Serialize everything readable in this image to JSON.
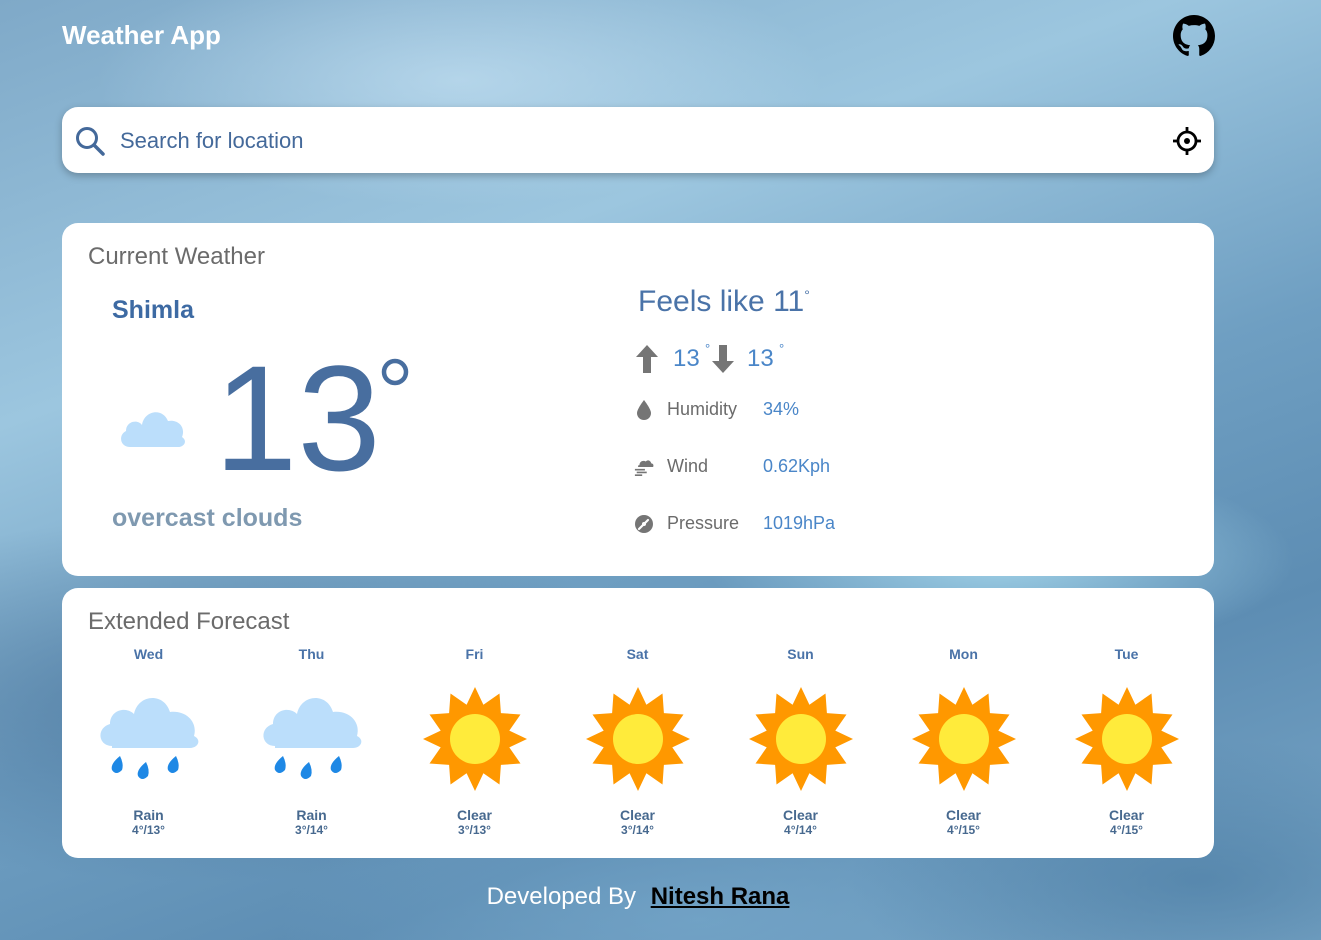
{
  "header": {
    "title": "Weather App",
    "github_icon": "github-icon"
  },
  "search": {
    "placeholder": "Search for location",
    "search_icon": "search-icon",
    "location_icon": "crosshair-icon"
  },
  "current": {
    "title": "Current Weather",
    "city": "Shimla",
    "temperature": "13",
    "description": "overcast clouds",
    "feels_like_label": "Feels like",
    "feels_like": "11",
    "max": "13",
    "min": "13",
    "degree": "°",
    "stats": [
      {
        "icon": "droplet-icon",
        "label": "Humidity",
        "value": "34%"
      },
      {
        "icon": "wind-icon",
        "label": "Wind",
        "value": "0.62Kph"
      },
      {
        "icon": "pressure-icon",
        "label": "Pressure",
        "value": "1019hPa"
      }
    ]
  },
  "forecast": {
    "title": "Extended Forecast",
    "days": [
      {
        "day": "Wed",
        "icon": "rain-icon",
        "condition": "Rain",
        "range": "4°/13°"
      },
      {
        "day": "Thu",
        "icon": "rain-icon",
        "condition": "Rain",
        "range": "3°/14°"
      },
      {
        "day": "Fri",
        "icon": "sun-icon",
        "condition": "Clear",
        "range": "3°/13°"
      },
      {
        "day": "Sat",
        "icon": "sun-icon",
        "condition": "Clear",
        "range": "3°/14°"
      },
      {
        "day": "Sun",
        "icon": "sun-icon",
        "condition": "Clear",
        "range": "4°/14°"
      },
      {
        "day": "Mon",
        "icon": "sun-icon",
        "condition": "Clear",
        "range": "4°/15°"
      },
      {
        "day": "Tue",
        "icon": "sun-icon",
        "condition": "Clear",
        "range": "4°/15°"
      }
    ]
  },
  "footer": {
    "text": "Developed By",
    "author": "Nitesh Rana"
  },
  "colors": {
    "accent": "#4a73a8",
    "value": "#4a86c8",
    "sun": "#ff9800",
    "sun_core": "#ffeb3b",
    "cloud": "#bbdefb",
    "rain": "#1e88e5"
  }
}
